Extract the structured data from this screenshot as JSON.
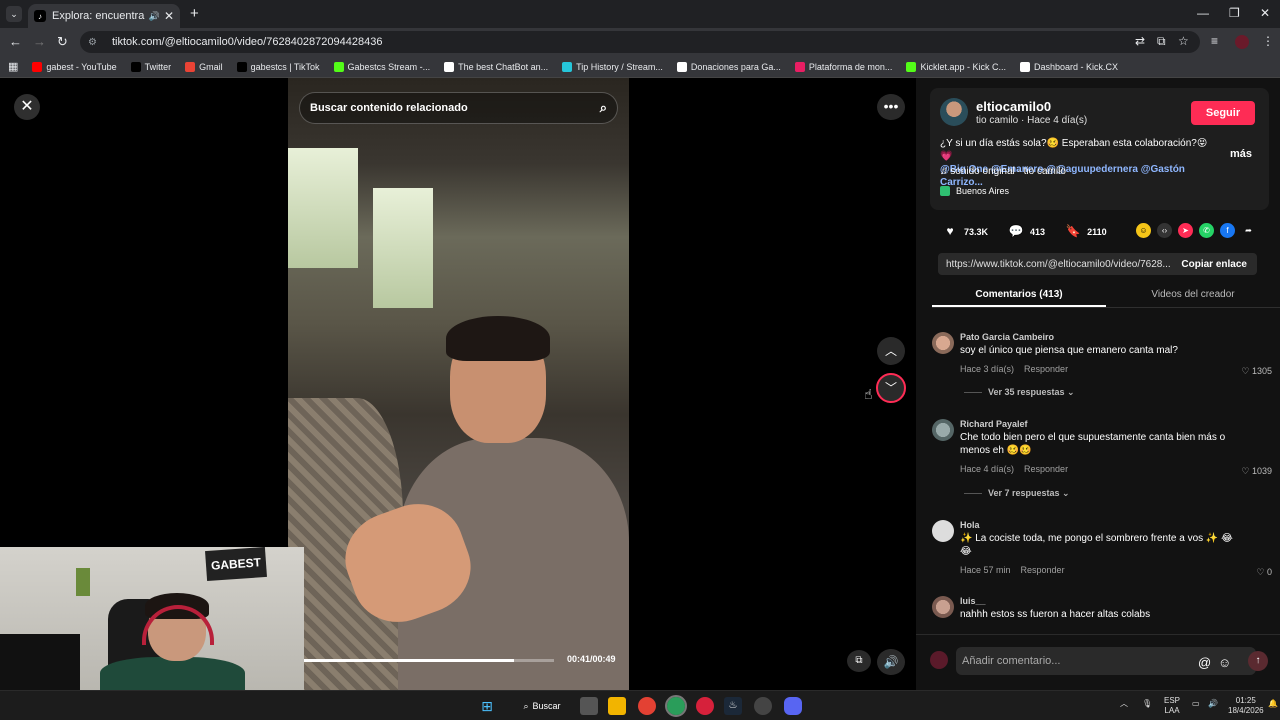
{
  "browser": {
    "tab_title": "Explora: encuentra tus víde",
    "tab_close": "✕",
    "new_tab": "+",
    "url": "tiktok.com/@eltiocamilo0/video/7628402872094428436",
    "bookmarks": [
      {
        "label": "gabest - YouTube",
        "color": "#ff0000"
      },
      {
        "label": "Twitter",
        "color": "#000000"
      },
      {
        "label": "Gmail",
        "color": "#ea4335"
      },
      {
        "label": "gabestcs | TikTok",
        "color": "#000000"
      },
      {
        "label": "Gabestcs Stream -...",
        "color": "#53fc18"
      },
      {
        "label": "The best ChatBot an...",
        "color": "#ffffff"
      },
      {
        "label": "Tip History / Stream...",
        "color": "#26c6da"
      },
      {
        "label": "Donaciones para Ga...",
        "color": "#ffffff"
      },
      {
        "label": "Plataforma de mon...",
        "color": "#e91e63"
      },
      {
        "label": "Kicklet.app - Kick C...",
        "color": "#53fc18"
      },
      {
        "label": "Dashboard - Kick.CX",
        "color": "#ffffff"
      }
    ]
  },
  "video": {
    "search_placeholder": "Buscar contenido relacionado",
    "time": "00:41/00:49",
    "progress": 0.84
  },
  "creator": {
    "username": "eltiocamilo0",
    "subline": "tio camilo · Hace 4 día(s)",
    "follow_label": "Seguir",
    "caption_text": "¿Y si un día estás sola?🥴 Esperaban esta colaboración?😝 💗",
    "caption_mentions": "@Big One @Emanero @@aguupedernera @Gastón Carrizo...",
    "more_label": "más",
    "sound": "♫  sonido original - tio camilo",
    "location": "Buenos Aires"
  },
  "stats": {
    "likes": "73.3K",
    "comments": "413",
    "saves": "2110"
  },
  "share": {
    "link": "https://www.tiktok.com/@eltiocamilo0/video/7628...",
    "copy_label": "Copiar enlace"
  },
  "tabs": {
    "comments": "Comentarios (413)",
    "creator_videos": "Videos del creador"
  },
  "comments": [
    {
      "name": "Pato Garcia Cambeiro",
      "text": "soy el único que piensa que emanero canta mal?",
      "time": "Hace 3 día(s)",
      "reply": "Responder",
      "likes": "1305",
      "replies": "Ver 35 respuestas ⌄"
    },
    {
      "name": "Richard Payalef",
      "text": "Che todo bien pero el que supuestamente canta bien más o menos eh 🥴🥴",
      "time": "Hace 4 día(s)",
      "reply": "Responder",
      "likes": "1039",
      "replies": "Ver 7 respuestas ⌄"
    },
    {
      "name": "Hola",
      "text": "✨ La cociste toda, me pongo el sombrero frente a vos ✨ 😂😂",
      "time": "Hace 57 min",
      "reply": "Responder",
      "likes": "0"
    },
    {
      "name": "luis__",
      "text": "nahhh estos ss fueron a hacer altas colabs"
    }
  ],
  "composer": {
    "placeholder": "Añadir comentario...",
    "at": "@",
    "emoji": "☺"
  },
  "webcam": {
    "logo_text": "GABEST"
  },
  "taskbar": {
    "search_label": "Buscar",
    "lang": "ESP",
    "lang_sub": "LAA",
    "time": "01:25",
    "date": "18/4/2026"
  }
}
